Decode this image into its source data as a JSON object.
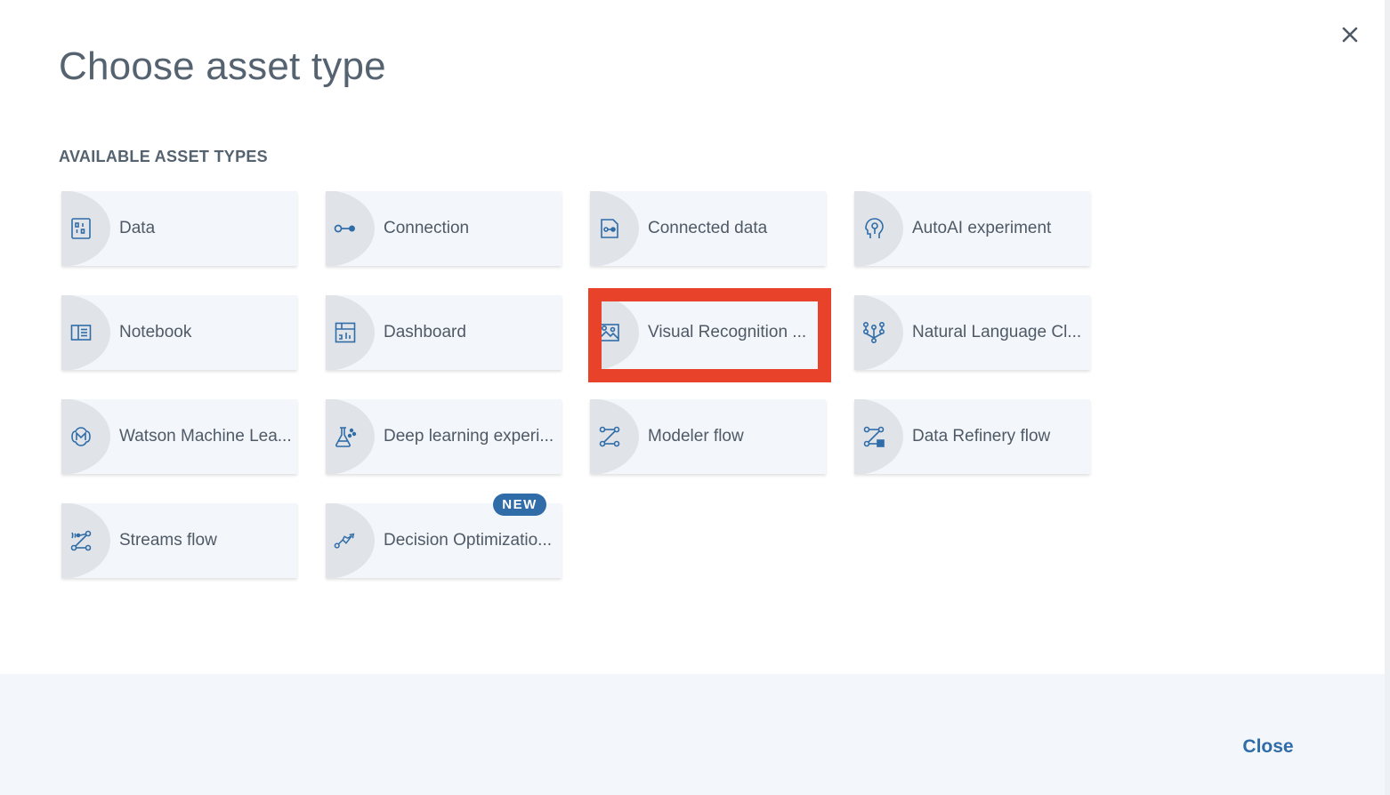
{
  "dialog": {
    "title": "Choose asset type",
    "section_label": "AVAILABLE ASSET TYPES",
    "close_label": "Close",
    "badge_new": "NEW"
  },
  "tiles": [
    {
      "label": "Data",
      "icon": "data-icon"
    },
    {
      "label": "Connection",
      "icon": "connection-icon"
    },
    {
      "label": "Connected data",
      "icon": "connected-data-icon"
    },
    {
      "label": "AutoAI experiment",
      "icon": "autoai-icon"
    },
    {
      "label": "Notebook",
      "icon": "notebook-icon"
    },
    {
      "label": "Dashboard",
      "icon": "dashboard-icon"
    },
    {
      "label": "Visual Recognition ...",
      "icon": "visual-recognition-icon"
    },
    {
      "label": "Natural Language Cl...",
      "icon": "natural-language-icon"
    },
    {
      "label": "Watson Machine Lea...",
      "icon": "machine-learning-icon"
    },
    {
      "label": "Deep learning experi...",
      "icon": "flask-icon"
    },
    {
      "label": "Modeler flow",
      "icon": "modeler-flow-icon"
    },
    {
      "label": "Data Refinery flow",
      "icon": "data-refinery-icon"
    },
    {
      "label": "Streams flow",
      "icon": "streams-flow-icon"
    },
    {
      "label": "Decision Optimizatio...",
      "icon": "decision-optimization-icon"
    }
  ],
  "colors": {
    "icon": "#2f6ca8",
    "highlight": "#e8422a",
    "badge": "#2f6ca8"
  }
}
